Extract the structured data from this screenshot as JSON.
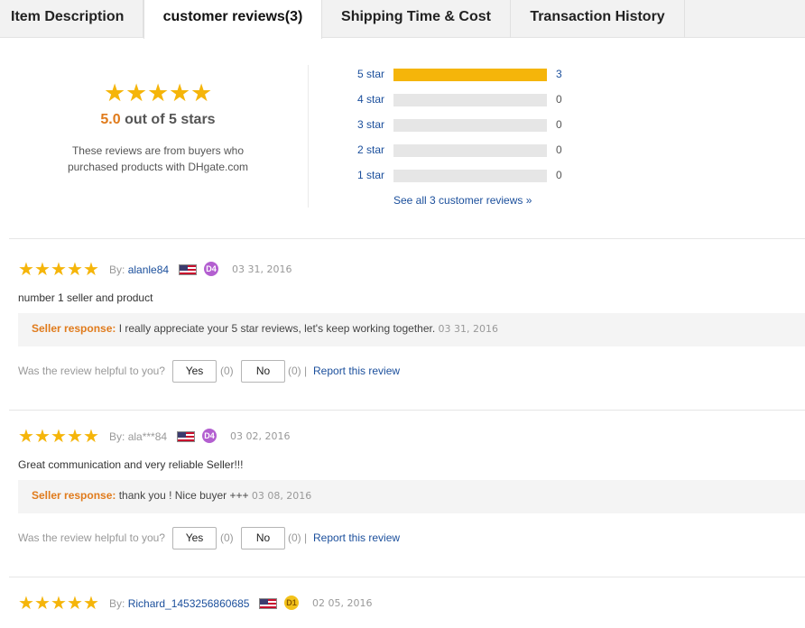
{
  "tabs": [
    {
      "label": "Item Description"
    },
    {
      "label": "customer reviews(3)",
      "active": true
    },
    {
      "label": "Shipping Time & Cost"
    },
    {
      "label": "Transaction History"
    }
  ],
  "summary": {
    "score": "5.0",
    "score_suffix": "out of 5 stars",
    "note_line1": "These reviews are from buyers who",
    "note_line2": "purchased products with DHgate.com",
    "stars_filled": 5,
    "histogram": [
      {
        "label": "5 star",
        "count": "3",
        "fraction": 1.0
      },
      {
        "label": "4 star",
        "count": "0",
        "fraction": 0
      },
      {
        "label": "3 star",
        "count": "0",
        "fraction": 0
      },
      {
        "label": "2 star",
        "count": "0",
        "fraction": 0
      },
      {
        "label": "1 star",
        "count": "0",
        "fraction": 0
      }
    ],
    "see_all": "See all 3 customer reviews »"
  },
  "reviews": [
    {
      "by_label": "By:",
      "user": "alanle84",
      "level": "D4",
      "date": "03 31, 2016",
      "text": "number 1 seller and product",
      "response_label": "Seller response:",
      "response_text": "I really appreciate your 5 star reviews, let's keep working together.",
      "response_date": "03 31, 2016",
      "helpful_q": "Was the review helpful to you?",
      "yes": "Yes",
      "yes_count": "(0)",
      "no": "No",
      "no_count": "(0) |",
      "report": "Report this review"
    },
    {
      "by_label": "By:",
      "user": "ala***84",
      "level": "D4",
      "date": "03 02, 2016",
      "text": "Great communication and very reliable Seller!!!",
      "response_label": "Seller response:",
      "response_text": "thank you ! Nice buyer +++",
      "response_date": "03 08, 2016",
      "helpful_q": "Was the review helpful to you?",
      "yes": "Yes",
      "yes_count": "(0)",
      "no": "No",
      "no_count": "(0) |",
      "report": "Report this review"
    },
    {
      "by_label": "By:",
      "user": "Richard_1453256860685",
      "level": "D1",
      "date": "02 05, 2016"
    }
  ],
  "colors": {
    "star": "#f5b50a",
    "accent_orange": "#e07b1c",
    "link_blue": "#1b4f9c"
  },
  "icons": {
    "star": "star-icon",
    "flag": "us-flag-icon",
    "level": "buyer-level-badge-icon"
  }
}
